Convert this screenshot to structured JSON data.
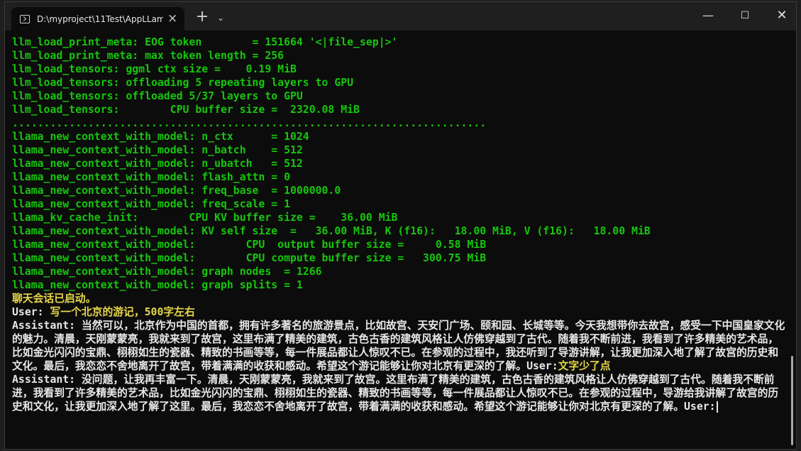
{
  "window": {
    "tab_title": "D:\\myproject\\11Test\\AppLLam",
    "tab_close": "×",
    "new_tab": "+",
    "dropdown": "⌄",
    "minimize": "—",
    "maximize": "☐",
    "close": "✕"
  },
  "log_lines": [
    "llm_load_print_meta: EOG token        = 151664 '<|file_sep|>'",
    "llm_load_print_meta: max token length = 256",
    "llm_load_tensors: ggml ctx size =    0.19 MiB",
    "llm_load_tensors: offloading 5 repeating layers to GPU",
    "llm_load_tensors: offloaded 5/37 layers to GPU",
    "llm_load_tensors:        CPU buffer size =  2320.08 MiB",
    "...........................................................................",
    "llama_new_context_with_model: n_ctx      = 1024",
    "llama_new_context_with_model: n_batch    = 512",
    "llama_new_context_with_model: n_ubatch   = 512",
    "llama_new_context_with_model: flash_attn = 0",
    "llama_new_context_with_model: freq_base  = 1000000.0",
    "llama_new_context_with_model: freq_scale = 1",
    "llama_kv_cache_init:        CPU KV buffer size =    36.00 MiB",
    "llama_new_context_with_model: KV self size  =   36.00 MiB, K (f16):   18.00 MiB, V (f16):   18.00 MiB",
    "llama_new_context_with_model:        CPU  output buffer size =     0.58 MiB",
    "llama_new_context_with_model:        CPU compute buffer size =   300.75 MiB",
    "llama_new_context_with_model: graph nodes  = 1266",
    "llama_new_context_with_model: graph splits = 1"
  ],
  "chat": {
    "started": "聊天会话已启动。",
    "user_label": "User:",
    "user_msg_1": " 写一个北京的游记，500字左右",
    "assistant_label": "Assistant:",
    "assistant_msg_1": " 当然可以，北京作为中国的首都，拥有许多著名的旅游景点，比如故宫、天安门广场、颐和园、长城等等。今天我想带你去故宫，感受一下中国皇家文化的魅力。清晨，天刚蒙蒙亮，我就来到了故宫，这里布满了精美的建筑，古色古香的建筑风格让人仿佛穿越到了古代。随着我不断前进，我看到了许多精美的艺术品，比如金光闪闪的宝鼎、栩栩如生的瓷器、精致的书画等等，每一件展品都让人惊叹不已。在参观的过程中，我还听到了导游讲解，让我更加深入地了解了故宫的历史和文化。最后，我恋恋不舍地离开了故宫，带着满满的收获和感动。希望这个游记能够让你对北京有更深的了解。",
    "user_msg_2": "文字少了点",
    "assistant_msg_2": " 没问题，让我再丰富一下。清晨，天刚蒙蒙亮，我就来到了故宫。这里布满了精美的建筑，古色古香的建筑风格让人仿佛穿越到了古代。随着我不断前进，我看到了许多精美的艺术品，比如金光闪闪的宝鼎、栩栩如生的瓷器、精致的书画等等，每一件展品都让人惊叹不已。在参观的过程中，导游给我讲解了故宫的历史和文化，让我更加深入地了解了这里。最后，我恋恋不舍地离开了故宫，带着满满的收获和感动。希望这个游记能够让你对北京有更深的了解。"
  }
}
